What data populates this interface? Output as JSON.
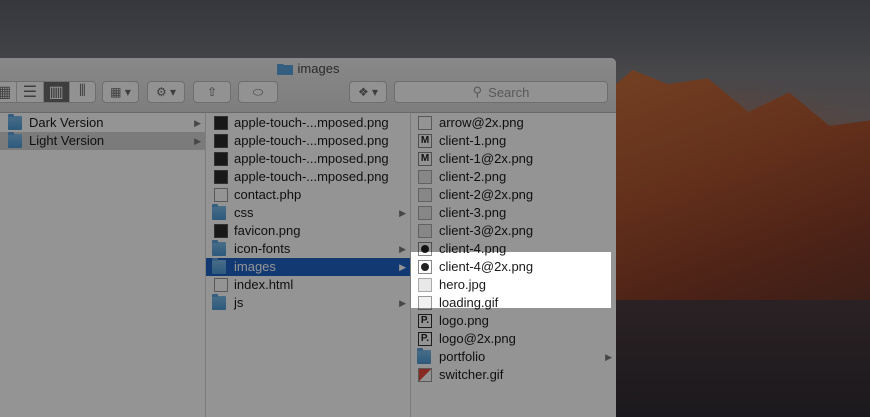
{
  "window": {
    "title": "images"
  },
  "toolbar": {
    "search_placeholder": "Search",
    "view_icons": [
      "icon-view-icon",
      "list-view-icon",
      "column-view-icon",
      "coverflow-view-icon"
    ]
  },
  "col1": {
    "items": [
      {
        "label": "Dark Version",
        "icon": "folder-icon"
      },
      {
        "label": "Light Version",
        "icon": "folder-icon",
        "selected": true
      }
    ]
  },
  "col2": {
    "items": [
      {
        "label": "apple-touch-...mposed.png"
      },
      {
        "label": "apple-touch-...mposed.png"
      },
      {
        "label": "apple-touch-...mposed.png"
      },
      {
        "label": "apple-touch-...mposed.png"
      },
      {
        "label": "contact.php"
      },
      {
        "label": "css"
      },
      {
        "label": "favicon.png"
      },
      {
        "label": "icon-fonts"
      },
      {
        "label": "images"
      },
      {
        "label": "index.html"
      },
      {
        "label": "js"
      }
    ]
  },
  "col3": {
    "items": [
      {
        "label": "arrow@2x.png"
      },
      {
        "label": "client-1.png"
      },
      {
        "label": "client-1@2x.png"
      },
      {
        "label": "client-2.png"
      },
      {
        "label": "client-2@2x.png"
      },
      {
        "label": "client-3.png"
      },
      {
        "label": "client-3@2x.png"
      },
      {
        "label": "client-4.png"
      },
      {
        "label": "client-4@2x.png"
      },
      {
        "label": "hero.jpg"
      },
      {
        "label": "loading.gif"
      },
      {
        "label": "logo.png"
      },
      {
        "label": "logo@2x.png"
      },
      {
        "label": "portfolio"
      },
      {
        "label": "switcher.gif"
      }
    ]
  }
}
